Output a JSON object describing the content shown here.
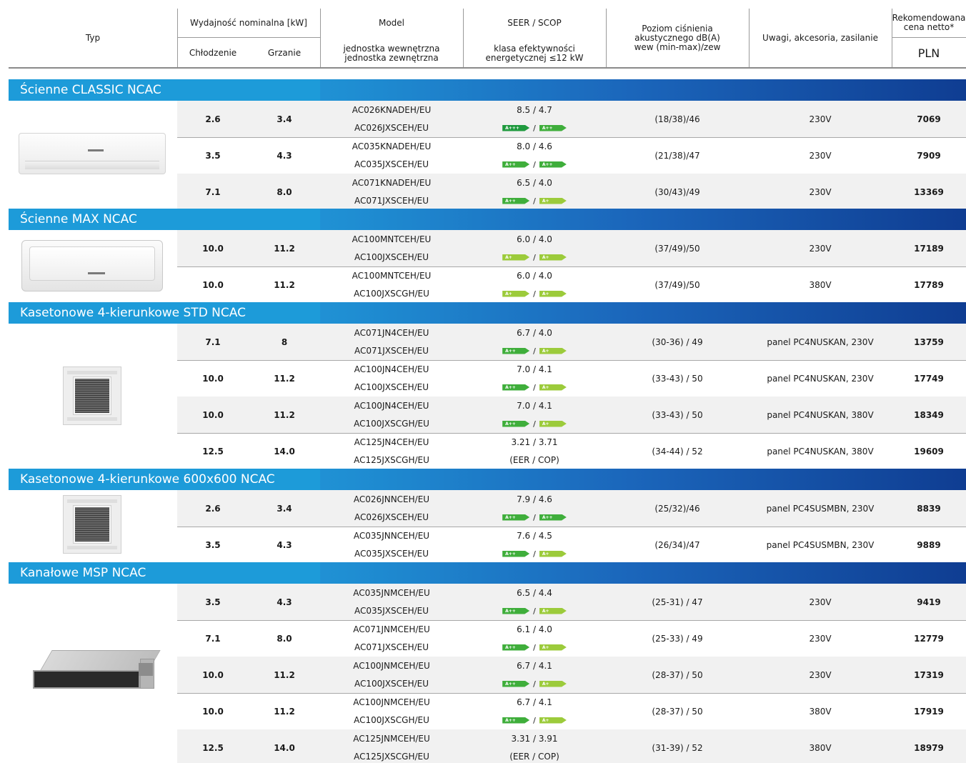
{
  "header": {
    "typ": "Typ",
    "capacity": "Wydajność nominalna [kW]",
    "cooling": "Chłodzenie",
    "heating": "Grzanie",
    "model": "Model",
    "model_sub1": "jednostka wewnętrzna",
    "model_sub2": "jednostka zewnętrzna",
    "seer": "SEER / SCOP",
    "seer_sub1": "klasa efektywności",
    "seer_sub2": "energetycznej  ≤12 kW",
    "noise1": "Poziom ciśnienia",
    "noise2": "akustycznego dB(A)",
    "noise3": "wew (min-max)/zew",
    "notes": "Uwagi, akcesoria, zasilanie",
    "price1": "Rekomendowana",
    "price2": "cena netto*",
    "currency": "PLN"
  },
  "energy_colors": {
    "A+++": "#1f9a3e",
    "A++": "#3fae3b",
    "A+": "#9ccb3b"
  },
  "sections": [
    {
      "title": "Ścienne CLASSIC NCAC",
      "image": "wall-unit-classic",
      "rows": [
        {
          "cooling": "2.6",
          "heating": "3.4",
          "indoor": "AC026KNADEH/EU",
          "outdoor": "AC026JXSCEH/EU",
          "seer": "8.5 / 4.7",
          "badge1": "A+++",
          "badge2": "A++",
          "noise": "(18/38)/46",
          "notes": "230V",
          "price": "7069"
        },
        {
          "cooling": "3.5",
          "heating": "4.3",
          "indoor": "AC035KNADEH/EU",
          "outdoor": "AC035JXSCEH/EU",
          "seer": "8.0 / 4.6",
          "badge1": "A++",
          "badge2": "A++",
          "noise": "(21/38)/47",
          "notes": "230V",
          "price": "7909"
        },
        {
          "cooling": "7.1",
          "heating": "8.0",
          "indoor": "AC071KNADEH/EU",
          "outdoor": "AC071JXSCEH/EU",
          "seer": "6.5 / 4.0",
          "badge1": "A++",
          "badge2": "A+",
          "noise": "(30/43)/49",
          "notes": "230V",
          "price": "13369"
        }
      ]
    },
    {
      "title": "Ścienne MAX NCAC",
      "image": "wall-unit-max",
      "rows": [
        {
          "cooling": "10.0",
          "heating": "11.2",
          "indoor": "AC100MNTCEH/EU",
          "outdoor": "AC100JXSCEH/EU",
          "seer": "6.0 / 4.0",
          "badge1": "A+",
          "badge2": "A+",
          "noise": "(37/49)/50",
          "notes": "230V",
          "price": "17189"
        },
        {
          "cooling": "10.0",
          "heating": "11.2",
          "indoor": "AC100MNTCEH/EU",
          "outdoor": "AC100JXSCGH/EU",
          "seer": "6.0 / 4.0",
          "badge1": "A+",
          "badge2": "A+",
          "noise": "(37/49)/50",
          "notes": "380V",
          "price": "17789"
        }
      ]
    },
    {
      "title": "Kasetonowe 4-kierunkowe STD NCAC",
      "image": "cassette-unit-std",
      "rows": [
        {
          "cooling": "7.1",
          "heating": "8",
          "indoor": "AC071JN4CEH/EU",
          "outdoor": "AC071JXSCEH/EU",
          "seer": "6.7 / 4.0",
          "badge1": "A++",
          "badge2": "A+",
          "noise": "(30-36) / 49",
          "notes": "panel PC4NUSKAN, 230V",
          "price": "13759"
        },
        {
          "cooling": "10.0",
          "heating": "11.2",
          "indoor": "AC100JN4CEH/EU",
          "outdoor": "AC100JXSCEH/EU",
          "seer": "7.0 / 4.1",
          "badge1": "A++",
          "badge2": "A+",
          "noise": "(33-43) / 50",
          "notes": "panel PC4NUSKAN, 230V",
          "price": "17749"
        },
        {
          "cooling": "10.0",
          "heating": "11.2",
          "indoor": "AC100JN4CEH/EU",
          "outdoor": "AC100JXSCGH/EU",
          "seer": "7.0 / 4.1",
          "badge1": "A++",
          "badge2": "A+",
          "noise": "(33-43) / 50",
          "notes": "panel PC4NUSKAN, 380V",
          "price": "18349"
        },
        {
          "cooling": "12.5",
          "heating": "14.0",
          "indoor": "AC125JN4CEH/EU",
          "outdoor": "AC125JXSCGH/EU",
          "seer": "3.21 / 3.71",
          "seer2": "(EER / COP)",
          "noise": "(34-44) / 52",
          "notes": "panel PC4NUSKAN, 380V",
          "price": "19609"
        }
      ]
    },
    {
      "title": "Kasetonowe 4-kierunkowe 600x600 NCAC",
      "image": "cassette-unit-600",
      "rows": [
        {
          "cooling": "2.6",
          "heating": "3.4",
          "indoor": "AC026JNNCEH/EU",
          "outdoor": "AC026JXSCEH/EU",
          "seer": "7.9 / 4.6",
          "badge1": "A++",
          "badge2": "A++",
          "noise": "(25/32)/46",
          "notes": "panel PC4SUSMBN, 230V",
          "price": "8839"
        },
        {
          "cooling": "3.5",
          "heating": "4.3",
          "indoor": "AC035JNNCEH/EU",
          "outdoor": "AC035JXSCEH/EU",
          "seer": "7.6 / 4.5",
          "badge1": "A++",
          "badge2": "A+",
          "noise": "(26/34)/47",
          "notes": "panel PC4SUSMBN, 230V",
          "price": "9889"
        }
      ]
    },
    {
      "title": "Kanałowe MSP NCAC",
      "image": "duct-unit-msp",
      "rows": [
        {
          "cooling": "3.5",
          "heating": "4.3",
          "indoor": "AC035JNMCEH/EU",
          "outdoor": "AC035JXSCEH/EU",
          "seer": "6.5 / 4.4",
          "badge1": "A++",
          "badge2": "A+",
          "noise": "(25-31) / 47",
          "notes": "230V",
          "price": "9419"
        },
        {
          "cooling": "7.1",
          "heating": "8.0",
          "indoor": "AC071JNMCEH/EU",
          "outdoor": "AC071JXSCEH/EU",
          "seer": "6.1 / 4.0",
          "badge1": "A++",
          "badge2": "A+",
          "noise": "(25-33) / 49",
          "notes": "230V",
          "price": "12779"
        },
        {
          "cooling": "10.0",
          "heating": "11.2",
          "indoor": "AC100JNMCEH/EU",
          "outdoor": "AC100JXSCEH/EU",
          "seer": "6.7 / 4.1",
          "badge1": "A++",
          "badge2": "A+",
          "noise": "(28-37) / 50",
          "notes": "230V",
          "price": "17319"
        },
        {
          "cooling": "10.0",
          "heating": "11.2",
          "indoor": "AC100JNMCEH/EU",
          "outdoor": "AC100JXSCGH/EU",
          "seer": "6.7 / 4.1",
          "badge1": "A++",
          "badge2": "A+",
          "noise": "(28-37) / 50",
          "notes": "380V",
          "price": "17919"
        },
        {
          "cooling": "12.5",
          "heating": "14.0",
          "indoor": "AC125JNMCEH/EU",
          "outdoor": "AC125JXSCGH/EU",
          "seer": "3.31 / 3.91",
          "seer2": "(EER / COP)",
          "noise": "(31-39) / 52",
          "notes": "380V",
          "price": "18979"
        }
      ]
    }
  ]
}
